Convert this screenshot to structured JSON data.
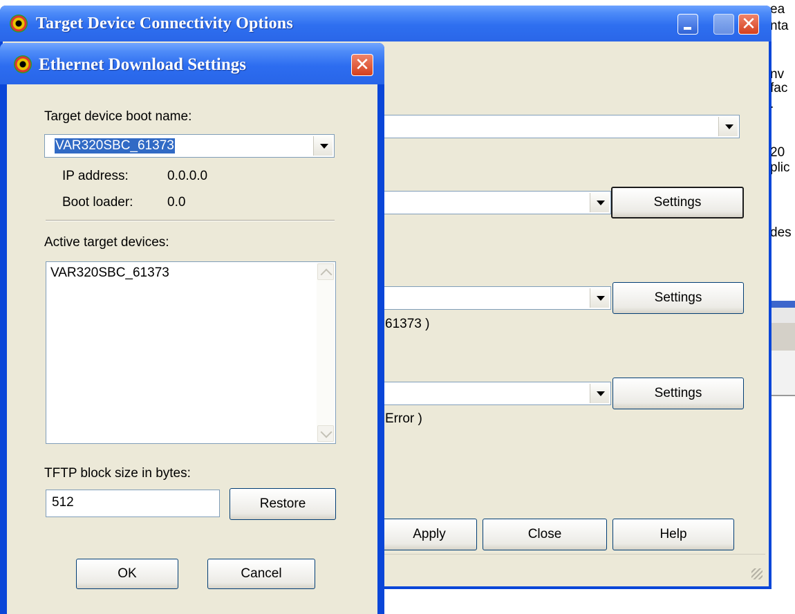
{
  "background_text": [
    "ea",
    "nta",
    "nv",
    "fac",
    ".",
    "20",
    "plic",
    "des"
  ],
  "main_window": {
    "title": "Target Device Connectivity Options",
    "row1_suffix": "61373 )",
    "row2_suffix": "Error )",
    "settings_label": "Settings",
    "apply_label": "Apply",
    "close_label": "Close",
    "help_label": "Help"
  },
  "dialog": {
    "title": "Ethernet Download Settings",
    "boot_name_label": "Target device boot name:",
    "boot_name_value": "VAR320SBC_61373",
    "ip_label": "IP address:",
    "ip_value": "0.0.0.0",
    "bootloader_label": "Boot loader:",
    "bootloader_value": "0.0",
    "active_label": "Active target devices:",
    "active_devices": [
      "VAR320SBC_61373"
    ],
    "tftp_label": "TFTP block size in bytes:",
    "tftp_value": "512",
    "restore_label": "Restore",
    "ok_label": "OK",
    "cancel_label": "Cancel"
  },
  "colors": {
    "titlebar_blue": "#2e6ff0",
    "dialog_face": "#ece9d8",
    "selection": "#316ac5",
    "close_red": "#d4401e"
  }
}
